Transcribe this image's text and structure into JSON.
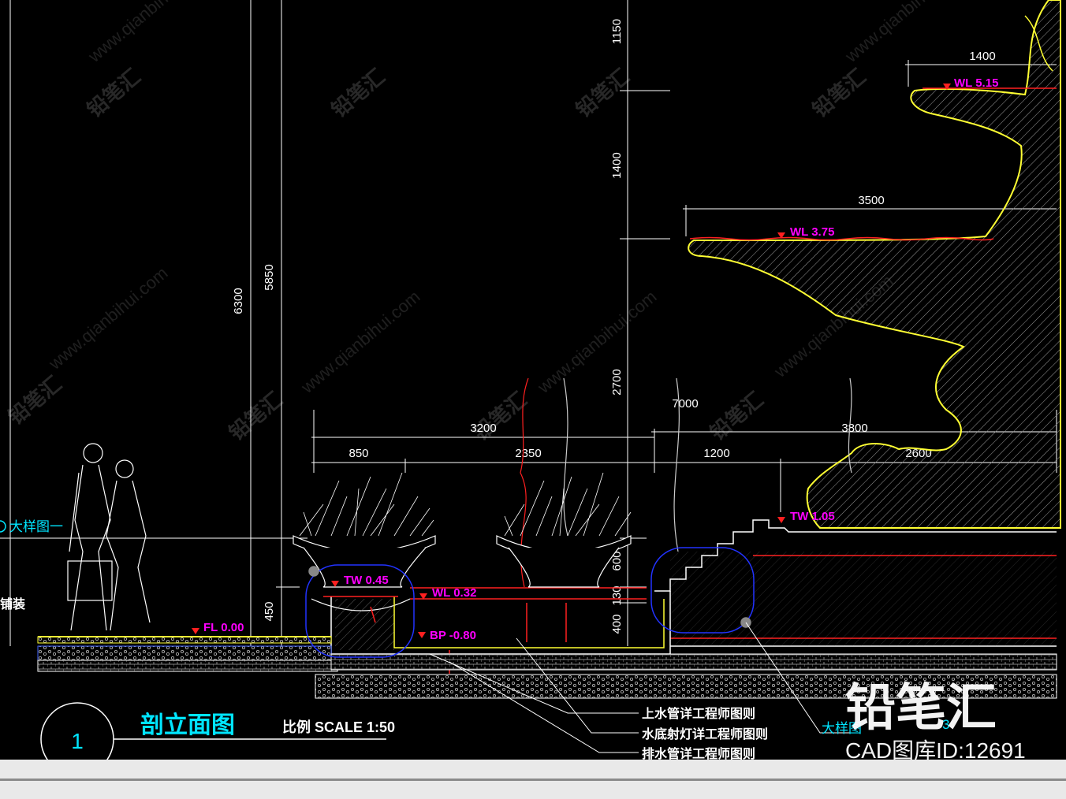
{
  "drawing": {
    "title_number": "1",
    "title": "剖立面图",
    "scale": "比例 SCALE  1:50",
    "detail_ref": "大样图一",
    "detail_ref_right": "大样图",
    "detail_ref_right_num": "3",
    "pavement_label": "铺装"
  },
  "dimensions": {
    "d1150": "1150",
    "d1400v": "1400",
    "d2700": "2700",
    "d6300": "6300",
    "d5850": "5850",
    "d1400h": "1400",
    "d3500": "3500",
    "d7000": "7000",
    "d3200": "3200",
    "d3800": "3800",
    "d850": "850",
    "d2350": "2350",
    "d1200": "1200",
    "d2600": "2600",
    "d600": "600",
    "d130": "130",
    "d400": "400",
    "d450": "450"
  },
  "levels": {
    "wl515": "WL 5.15",
    "wl375": "WL 3.75",
    "tw105": "TW 1.05",
    "tw045": "TW 0.45",
    "wl032": "WL 0.32",
    "fl000": "FL 0.00",
    "bp080": "BP -0.80"
  },
  "notes": [
    "上水管详工程师图则",
    "水底射灯详工程师图则",
    "排水管详工程师图则"
  ],
  "watermark": {
    "brand": "铅笔汇",
    "url": "www.qianbihui.com",
    "id_label": "CAD图库ID:12691"
  },
  "colors": {
    "background": "#000000",
    "dimension": "#ffffff",
    "level": "#ff00ff",
    "water": "#ff2020",
    "fountain": "#ffff33",
    "callout": "#2233ff",
    "title": "#00e5ff"
  }
}
